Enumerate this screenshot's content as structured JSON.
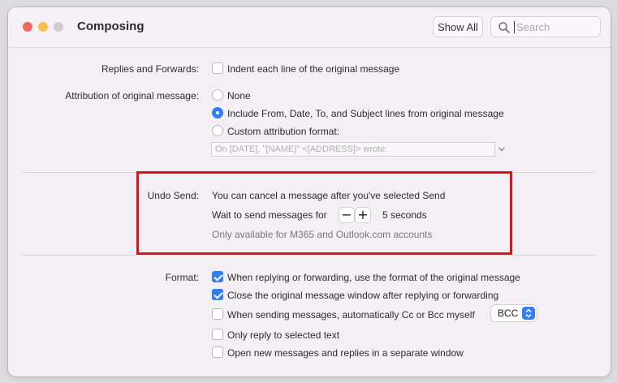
{
  "window": {
    "title": "Composing"
  },
  "toolbar": {
    "show_all_label": "Show All",
    "search_placeholder": "Search"
  },
  "replies": {
    "label": "Replies and Forwards:",
    "indent_label": "Indent each line of the original message",
    "indent_checked": false
  },
  "attribution": {
    "label": "Attribution of original message:",
    "options": [
      {
        "label": "None",
        "selected": false
      },
      {
        "label": "Include From, Date, To, and Subject lines from original message",
        "selected": true
      },
      {
        "label": "Custom attribution format:",
        "selected": false
      }
    ],
    "custom_format_value": "On [DATE], \"[NAME]\" <[ADDRESS]> wrote:"
  },
  "undo_send": {
    "label": "Undo Send:",
    "description": "You can cancel a message after you've selected Send",
    "wait_label": "Wait to send messages for",
    "seconds_text": "5 seconds",
    "note": "Only available for M365 and Outlook.com accounts",
    "minus_glyph": "−",
    "plus_glyph": "+"
  },
  "format": {
    "label": "Format:",
    "options": [
      {
        "label": "When replying or forwarding, use the format of the original message",
        "checked": true
      },
      {
        "label": "Close the original message window after replying or forwarding",
        "checked": true
      },
      {
        "label": "When sending messages, automatically Cc or Bcc myself",
        "checked": false
      },
      {
        "label": "Only reply to selected text",
        "checked": false
      },
      {
        "label": "Open new messages and replies in a separate window",
        "checked": false
      }
    ],
    "cc_bcc_value": "BCC"
  },
  "colors": {
    "accent": "#2f7ff6",
    "highlight_border": "#d9141c",
    "traffic_close": "#ed6a5e",
    "traffic_minimize": "#f4bf4f",
    "traffic_zoom": "#cfcbcf"
  }
}
